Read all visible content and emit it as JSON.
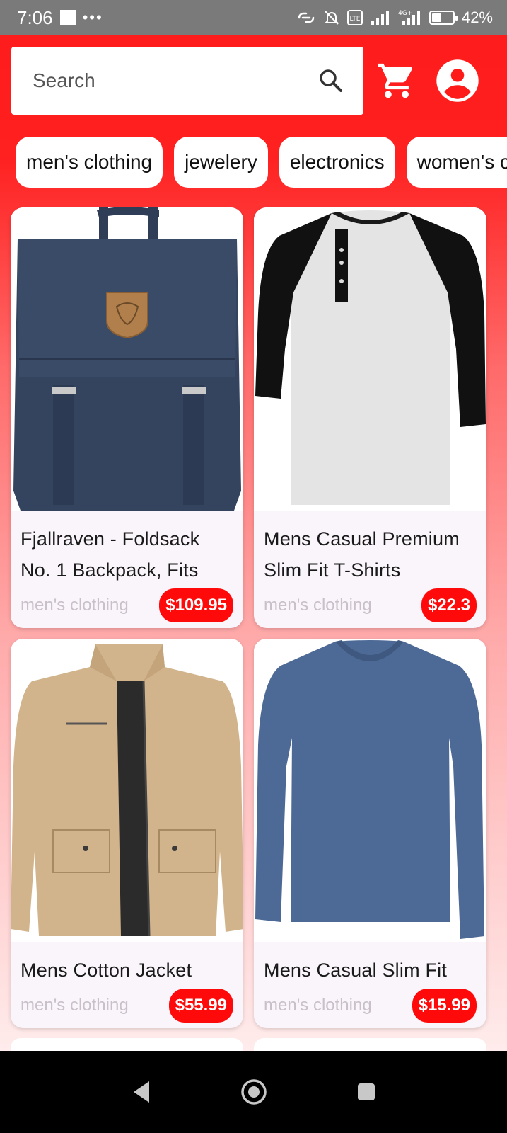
{
  "status_bar": {
    "time": "7:06",
    "dots": "•••",
    "network": "4G+",
    "battery": "42%"
  },
  "search": {
    "placeholder": "Search"
  },
  "categories": [
    "men's clothing",
    "jewelery",
    "electronics",
    "women's clothing"
  ],
  "products": [
    {
      "title": "Fjallraven - Foldsack No. 1 Backpack, Fits",
      "category": "men's clothing",
      "price": "$109.95"
    },
    {
      "title": "Mens Casual Premium Slim Fit T-Shirts",
      "category": "men's clothing",
      "price": "$22.3"
    },
    {
      "title": "Mens Cotton Jacket",
      "category": "men's clothing",
      "price": "$55.99"
    },
    {
      "title": "Mens Casual Slim Fit",
      "category": "men's clothing",
      "price": "$15.99"
    }
  ],
  "colors": {
    "accent": "#ff0a0a",
    "header_red": "#ff1a1a",
    "card_bg": "#faf5fb"
  }
}
